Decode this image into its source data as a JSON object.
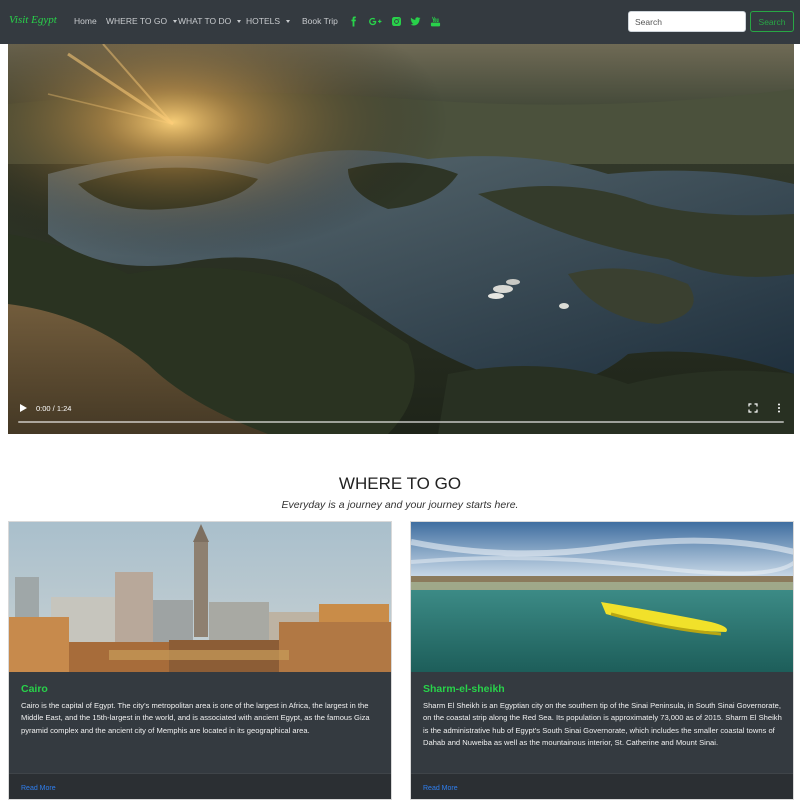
{
  "navbar": {
    "brand": "Visit Egypt",
    "items": [
      {
        "label": "Home",
        "dropdown": false
      },
      {
        "label": "WHERE TO GO",
        "dropdown": true
      },
      {
        "label": "WHAT TO DO",
        "dropdown": true
      },
      {
        "label": "HOTELS",
        "dropdown": true
      },
      {
        "label": "Book Trip",
        "dropdown": false
      }
    ],
    "social_icons": [
      "facebook-icon",
      "google-plus-icon",
      "instagram-icon",
      "twitter-icon",
      "youtube-icon"
    ],
    "search": {
      "placeholder": "Search",
      "button_label": "Search"
    },
    "accent_color": "#28a745"
  },
  "video": {
    "time": "0:00 / 1:24",
    "progress": 0,
    "controls": [
      "play-icon",
      "fullscreen-icon",
      "more-options-icon"
    ]
  },
  "section": {
    "title": "WHERE TO GO",
    "subtitle": "Everyday is a journey and your journey starts here."
  },
  "cards": [
    {
      "title": "Cairo",
      "text": "Cairo is the capital of Egypt. The city's metropolitan area is one of the largest in Africa, the largest in the Middle East, and the 15th-largest in the world, and is associated with ancient Egypt, as the famous Giza pyramid complex and the ancient city of Memphis are located in its geographical area.",
      "link": "Read More"
    },
    {
      "title": "Sharm-el-sheikh",
      "text": "Sharm El Sheikh is an Egyptian city on the southern tip of the Sinai Peninsula, in South Sinai Governorate, on the coastal strip along the Red Sea. Its population is approximately 73,000 as of 2015. Sharm El Sheikh is the administrative hub of Egypt's South Sinai Governorate, which includes the smaller coastal towns of Dahab and Nuweiba as well as the mountainous interior, St. Catherine and Mount Sinai.",
      "link": "Read More"
    }
  ]
}
